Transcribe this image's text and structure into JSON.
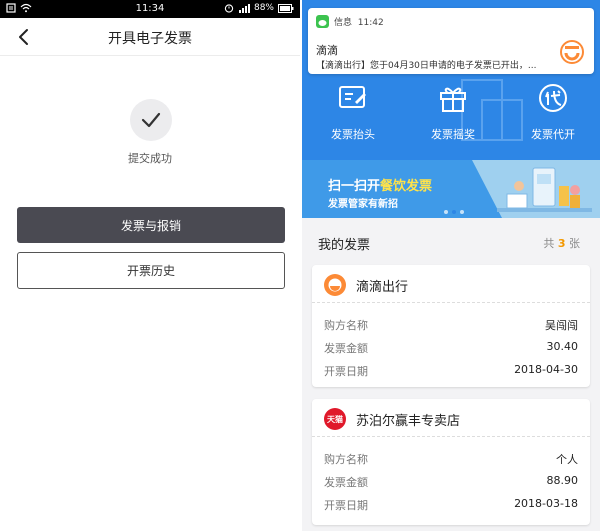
{
  "left": {
    "status": {
      "time": "11:34",
      "battery": "88%"
    },
    "nav": {
      "title": "开具电子发票"
    },
    "success": {
      "text": "提交成功"
    },
    "buttons": {
      "primary": "发票与报销",
      "secondary": "开票历史"
    }
  },
  "right": {
    "notification": {
      "app": "信息",
      "time": "11:42",
      "sender": "滴滴",
      "message": "【滴滴出行】您于04月30日申请的电子发票已开出，..."
    },
    "features": [
      {
        "label": "发票抬头",
        "icon": "invoice-title-icon"
      },
      {
        "label": "发票摇奖",
        "icon": "gift-box-icon"
      },
      {
        "label": "发票代开",
        "icon": "proxy-issue-icon"
      }
    ],
    "banner": {
      "line1_prefix": "扫一扫开",
      "line1_highlight": "餐饮发票",
      "line2": "发票管家有新招"
    },
    "section": {
      "title": "我的发票",
      "count_prefix": "共",
      "count": "3",
      "count_suffix": "张"
    },
    "invoices": [
      {
        "merchant": "滴滴出行",
        "rows": [
          {
            "label": "购方名称",
            "value": "吴闯闯"
          },
          {
            "label": "发票金额",
            "value": "30.40"
          },
          {
            "label": "开票日期",
            "value": "2018-04-30"
          }
        ]
      },
      {
        "merchant": "苏泊尔赢丰专卖店",
        "logo_text": "天猫",
        "rows": [
          {
            "label": "购方名称",
            "value": "个人"
          },
          {
            "label": "发票金额",
            "value": "88.90"
          },
          {
            "label": "开票日期",
            "value": "2018-03-18"
          }
        ]
      }
    ]
  },
  "colors": {
    "primary_blue": "#2d86e6",
    "dark_button": "#4a4a52",
    "highlight_yellow": "#ffe34a",
    "count_orange": "#f39800",
    "didi_orange": "#fc8a36",
    "tmall_red": "#e0182a"
  }
}
